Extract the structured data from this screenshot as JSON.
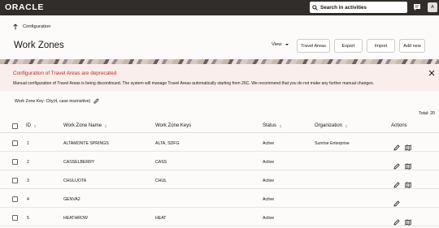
{
  "app": {
    "logo": "ORACLE",
    "search_placeholder": "Search in activities",
    "avatar_initial": "A"
  },
  "breadcrumb": {
    "label": "Configuration"
  },
  "page": {
    "title": "Work Zones"
  },
  "toolbar": {
    "view_label": "View",
    "travel_areas_label": "Travel Areas",
    "export_label": "Export",
    "import_label": "Import",
    "add_new_label": "Add new"
  },
  "alert": {
    "title": "Configuration of Travel Areas are deprecated",
    "text": "Manual configuration of Travel Areas is being discontinued. The system will manage Travel Areas automatically starting from 26C. We recommend that you do not make any further manual changes."
  },
  "key_line": {
    "label": "Work Zone Key: City(4, case insensitive)"
  },
  "total": "Total: 20",
  "table": {
    "columns": {
      "id": "ID",
      "name": "Work Zone Name",
      "keys": "Work Zone Keys",
      "status": "Status",
      "organization": "Organization",
      "actions": "Actions"
    },
    "rows": [
      {
        "id": "1",
        "name": "ALTAMONTE SPRINGS",
        "keys": "ALTA, SDFG",
        "status": "Active",
        "organization": "Sunrise Enterprise",
        "has_map": true
      },
      {
        "id": "2",
        "name": "CASSELBERRY",
        "keys": "CASS",
        "status": "Active",
        "organization": "",
        "has_map": true
      },
      {
        "id": "3",
        "name": "CHULUOTA",
        "keys": "CHUL",
        "status": "Active",
        "organization": "",
        "has_map": true
      },
      {
        "id": "4",
        "name": "GENVA2",
        "keys": "",
        "status": "Active",
        "organization": "",
        "has_map": false
      },
      {
        "id": "5",
        "name": "HEATHROW",
        "keys": "HEAT",
        "status": "Active",
        "organization": "",
        "has_map": true
      }
    ]
  },
  "colors": {
    "topbar": "#312d2a",
    "alert_bg": "#f9eeec",
    "alert_title": "#b3311f",
    "page_bg": "#fcfbfa"
  }
}
